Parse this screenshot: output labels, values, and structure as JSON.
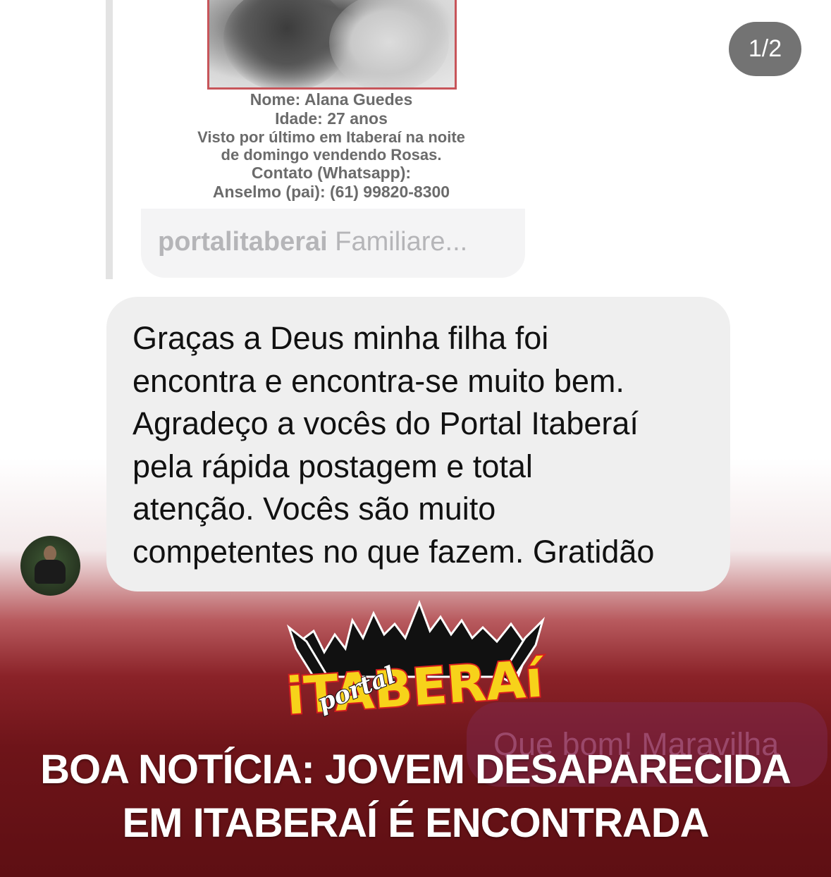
{
  "pagination": {
    "counter": "1/2"
  },
  "shared_post": {
    "poster_lines": [
      "Nome: Alana Guedes",
      "Idade: 27 anos",
      "Visto por último em Itaberaí na noite",
      "de domingo vendendo Rosas.",
      "Contato (Whatsapp):",
      "Anselmo (pai): (61) 99820-8300"
    ],
    "caption_user": "portalitaberai",
    "caption_text": " Familiare..."
  },
  "message": {
    "lines": [
      "Graças a Deus minha filha foi",
      "encontra e encontra-se muito bem.",
      "Agradeço a vocês do Portal Itaberaí",
      "pela rápida postagem e total",
      "atenção. Vocês são muito",
      "competentes no que fazem. Gratidão"
    ]
  },
  "outgoing_message": {
    "text": "Que bom! Maravilha"
  },
  "logo": {
    "small_text": "portal",
    "big_text": "iTABERAí"
  },
  "headline": {
    "line1": "BOA NOTÍCIA: JOVEM DESAPARECIDA",
    "line2": "EM ITABERAÍ É ENCONTRADA"
  },
  "colors": {
    "poster_border": "#c7555a",
    "headline_bg": "#6e1419",
    "logo_yellow": "#f7d21a",
    "logo_red": "#d61f1f"
  }
}
